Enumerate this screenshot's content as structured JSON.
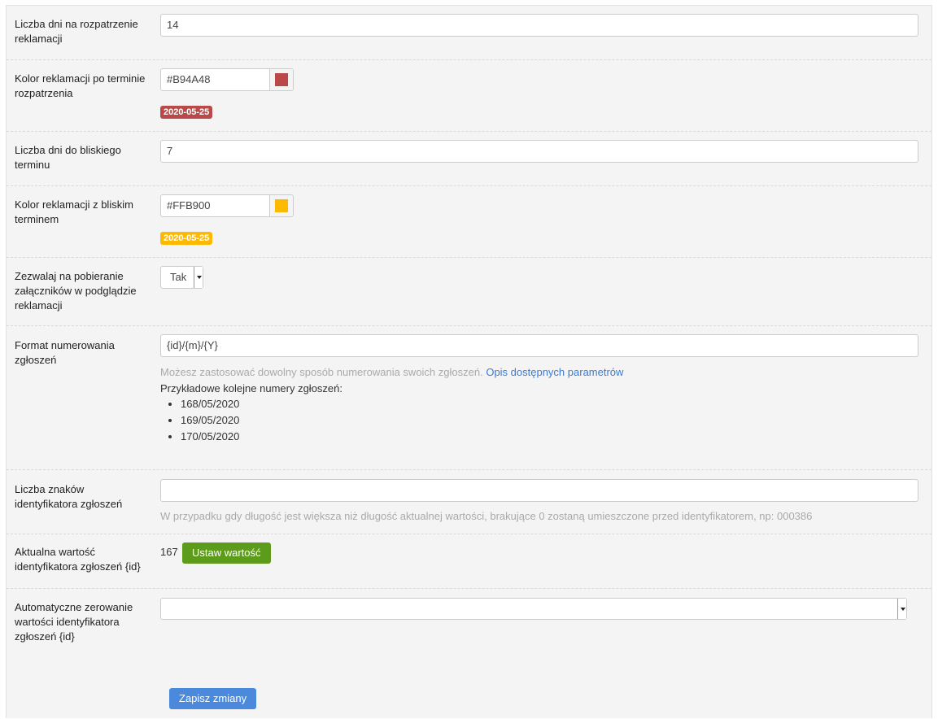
{
  "fields": {
    "days_to_resolve": {
      "label": "Liczba dni na rozpatrzenie reklamacji",
      "value": "14"
    },
    "overdue_color": {
      "label": "Kolor reklamacji po terminie rozpatrzenia",
      "value": "#B94A48",
      "color": "#B94A48",
      "badge": "2020-05-25"
    },
    "days_to_deadline": {
      "label": "Liczba dni do bliskiego terminu",
      "value": "7"
    },
    "near_deadline_color": {
      "label": "Kolor reklamacji z bliskim terminem",
      "value": "#FFB900",
      "color": "#FFB900",
      "badge": "2020-05-25"
    },
    "allow_attachments": {
      "label": "Zezwalaj na pobieranie załączników w podglądzie reklamacji",
      "value": "Tak"
    },
    "number_format": {
      "label": "Format numerowania zgłoszeń",
      "value": "{id}/{m}/{Y}",
      "help": "Możesz zastosować dowolny sposób numerowania swoich zgłoszeń.",
      "help_link": "Opis dostępnych parametrów",
      "examples_title": "Przykładowe kolejne numery zgłoszeń:",
      "examples": [
        "168/05/2020",
        "169/05/2020",
        "170/05/2020"
      ]
    },
    "id_length": {
      "label": "Liczba znaków identyfikatora zgłoszeń",
      "value": "",
      "help": "W przypadku gdy długość jest większa niż długość aktualnej wartości, brakujące 0 zostaną umieszczone przed identyfikatorem, np: 000386"
    },
    "current_id": {
      "label": "Aktualna wartość identyfikatora zgłoszeń {id}",
      "value": "167",
      "button": "Ustaw wartość"
    },
    "auto_reset": {
      "label": "Automatyczne zerowanie wartości identyfikatora zgłoszeń {id}",
      "value": ""
    }
  },
  "save_button": "Zapisz zmiany",
  "colors": {
    "accent_blue": "#4a89dc",
    "accent_green": "#5c9c1a"
  }
}
